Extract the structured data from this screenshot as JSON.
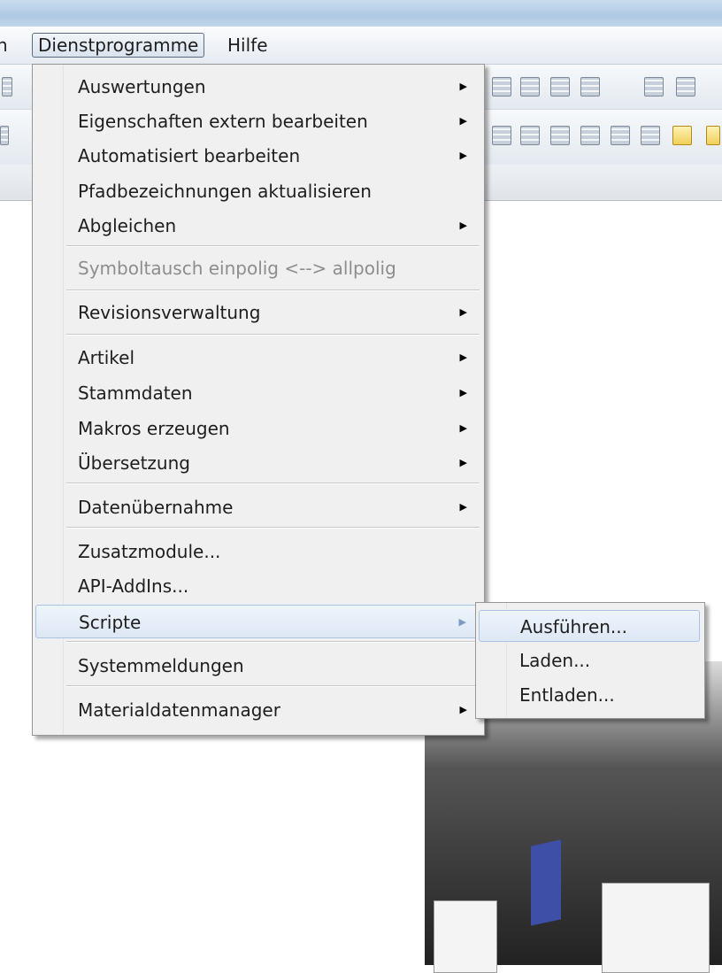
{
  "menubar": {
    "partial_item": "n",
    "dienstprogramme": "Dienstprogramme",
    "hilfe": "Hilfe"
  },
  "menu": {
    "items": [
      {
        "label": "Auswertungen",
        "submenu": true
      },
      {
        "label": "Eigenschaften extern bearbeiten",
        "submenu": true
      },
      {
        "label": "Automatisiert bearbeiten",
        "submenu": true
      },
      {
        "label": "Pfadbezeichnungen aktualisieren",
        "submenu": false
      },
      {
        "label": "Abgleichen",
        "submenu": true
      },
      {
        "label": "Symboltausch einpolig <--> allpolig",
        "submenu": false,
        "disabled": true
      },
      {
        "label": "Revisionsverwaltung",
        "submenu": true
      },
      {
        "label": "Artikel",
        "submenu": true
      },
      {
        "label": "Stammdaten",
        "submenu": true
      },
      {
        "label": "Makros erzeugen",
        "submenu": true
      },
      {
        "label": "Übersetzung",
        "submenu": true
      },
      {
        "label": "Datenübernahme",
        "submenu": true
      },
      {
        "label": "Zusatzmodule...",
        "submenu": false
      },
      {
        "label": "API-AddIns...",
        "submenu": false
      },
      {
        "label": "Scripte",
        "submenu": true,
        "highlighted": true
      },
      {
        "label": "Systemmeldungen",
        "submenu": false
      },
      {
        "label": "Materialdatenmanager",
        "submenu": true
      }
    ],
    "arrow_glyph": "▶"
  },
  "submenu": {
    "items": [
      {
        "label": "Ausführen...",
        "highlighted": true
      },
      {
        "label": "Laden..."
      },
      {
        "label": "Entladen..."
      }
    ]
  },
  "colors": {
    "menu_bg": "#f0f0f0",
    "highlight": "#dde8f6",
    "highlight_border": "#a8c3e6",
    "disabled_text": "#8d8d8d"
  }
}
